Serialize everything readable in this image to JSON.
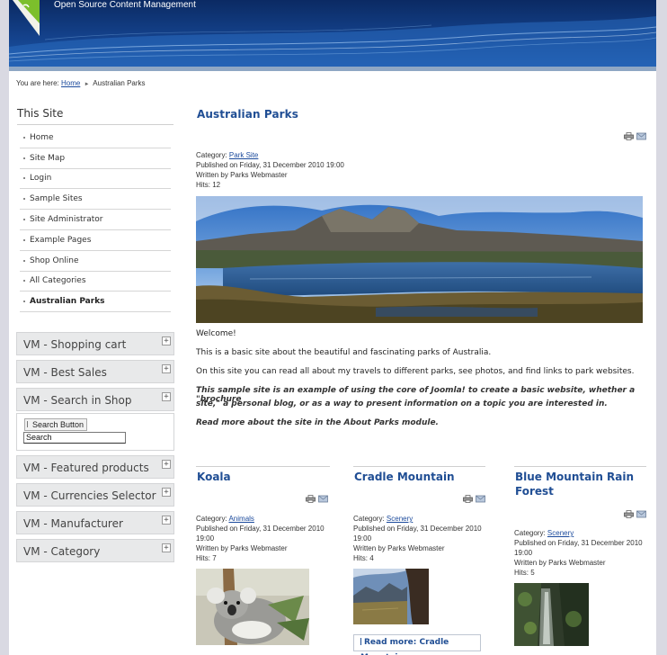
{
  "header": {
    "tagline": "Open Source Content Management"
  },
  "breadcrumb": {
    "prefix": "You are here:",
    "home": "Home",
    "current": "Australian Parks"
  },
  "sidebar": {
    "title": "This Site",
    "items": [
      {
        "label": "Home"
      },
      {
        "label": "Site Map"
      },
      {
        "label": "Login"
      },
      {
        "label": "Sample Sites"
      },
      {
        "label": "Site Administrator"
      },
      {
        "label": "Example Pages"
      },
      {
        "label": "Shop Online"
      },
      {
        "label": "All Categories"
      },
      {
        "label": "Australian Parks",
        "active": true
      }
    ],
    "modules": [
      {
        "title": "VM - Shopping cart"
      },
      {
        "title": "VM - Best Sales"
      },
      {
        "title": "VM - Search in Shop"
      },
      {
        "title": "VM - Featured products"
      },
      {
        "title": "VM - Currencies Selector"
      },
      {
        "title": "VM - Manufacturer"
      },
      {
        "title": "VM - Category"
      }
    ],
    "search": {
      "button_label": "Search Button",
      "input_value": "Search"
    }
  },
  "article": {
    "title": "Australian Parks",
    "category_label": "Category:",
    "category": "Park Site",
    "published": "Published on Friday, 31 December 2010 19:00",
    "author": "Written by Parks Webmaster",
    "hits": "Hits: 12",
    "paragraphs": [
      "Welcome!",
      "This is a basic site about the beautiful and fascinating parks of Australia.",
      "On this site you can read all about my travels to different parks, see photos, and find links to park websites."
    ],
    "emphasis_line1": "This sample site is an example of using the core of Joomla! to create a basic website, whether a \"brochure",
    "emphasis_line2": "site,\"  a personal blog, or as a way to present information on a topic you are interested in.",
    "emphasis_line3": "Read more about the site in the About Parks module."
  },
  "columns": [
    {
      "title": "Koala",
      "category_label": "Category:",
      "category": "Animals",
      "published_line1": "Published on Friday, 31 December 2010",
      "published_line2": "19:00",
      "author": "Written by Parks Webmaster",
      "hits": "Hits: 7"
    },
    {
      "title": "Cradle Mountain",
      "category_label": "Category:",
      "category": "Scenery",
      "published_line1": "Published on Friday, 31 December 2010",
      "published_line2": "19:00",
      "author": "Written by Parks Webmaster",
      "hits": "Hits: 4",
      "read_more": "Read more: Cradle Mountain"
    },
    {
      "title_line1": "Blue Mountain Rain",
      "title_line2": "Forest",
      "category_label": "Category:",
      "category": "Scenery",
      "published_line1": "Published on Friday, 31 December 2010",
      "published_line2": "19:00",
      "author": "Written by Parks Webmaster",
      "hits": "Hits: 5"
    }
  ],
  "icons": {
    "print": "print-icon",
    "email": "email-icon",
    "expand": "plus-toggle-icon"
  },
  "colors": {
    "link": "#1b4a9c",
    "title": "#204e94",
    "header_dark": "#0b2a63"
  }
}
